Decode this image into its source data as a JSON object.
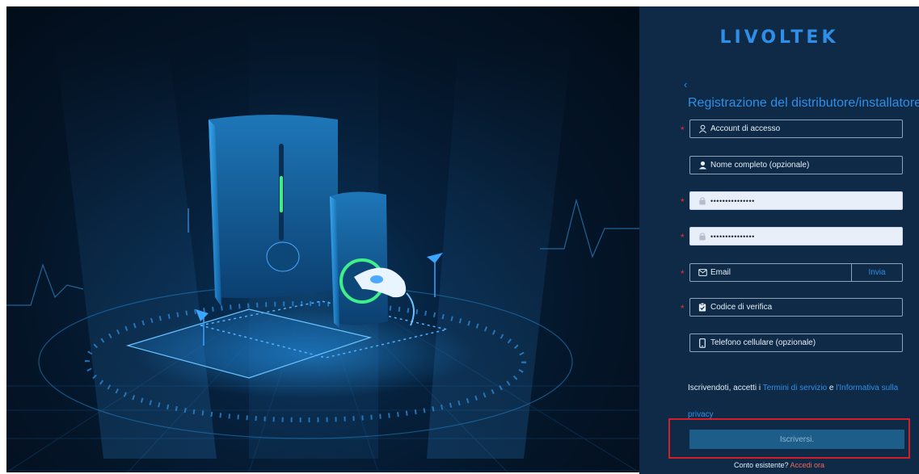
{
  "brand": {
    "logo_text": "LIVOLTEK"
  },
  "form": {
    "title": "Registrazione del distributore/installatore.",
    "back_icon": "chevron-left-icon",
    "fields": {
      "account": {
        "placeholder": "Account di accesso",
        "icon": "user-outline-icon",
        "required": true
      },
      "full_name": {
        "placeholder": "Nome completo (opzionale)",
        "icon": "user-solid-icon",
        "required": false
      },
      "password": {
        "value": "•••••••••••••••",
        "icon": "lock-icon",
        "required": true
      },
      "confirm_password": {
        "value": "•••••••••••••••",
        "icon": "lock-icon",
        "required": true
      },
      "email": {
        "placeholder": "Email",
        "icon": "mail-icon",
        "required": true,
        "send_label": "Invia"
      },
      "verification_code": {
        "placeholder": "Codice di verifica",
        "icon": "clipboard-check-icon",
        "required": true
      },
      "phone": {
        "placeholder": "Telefono cellulare (opzionale)",
        "icon": "mobile-phone-icon",
        "required": false
      }
    },
    "required_mark": "*",
    "terms": {
      "prefix": "Iscrivendoti, accetti i ",
      "terms_link": "Termini di servizio",
      "and": " e ",
      "privacy_link": "l'Informativa sulla privacy"
    },
    "submit_label": "Iscriversi.",
    "login_prompt": "Conto esistente? ",
    "login_link": "Accedi ora"
  },
  "colors": {
    "accent": "#2f8fe8",
    "panel_bg": "#0e2a47",
    "required": "#e5372f",
    "highlight_box": "#d32028",
    "login_link": "#f06a55"
  }
}
